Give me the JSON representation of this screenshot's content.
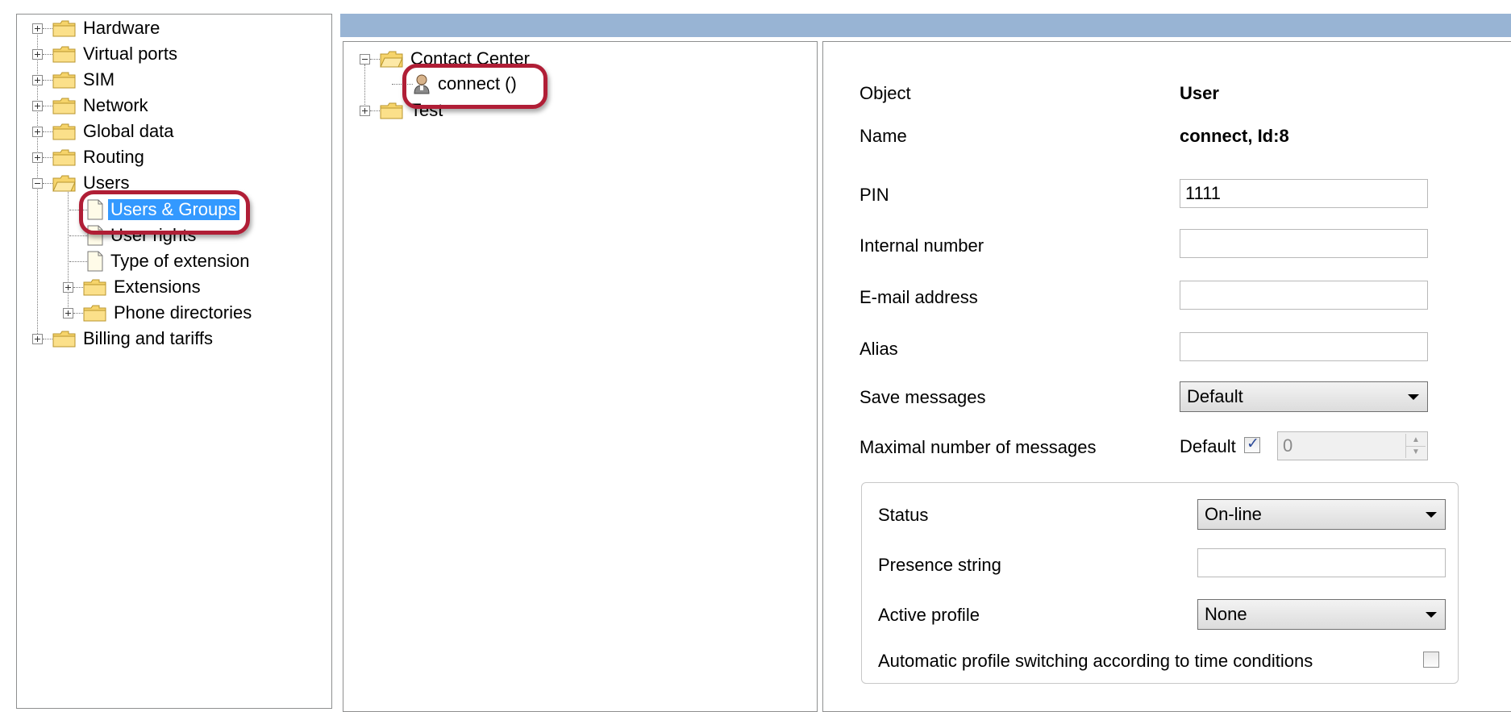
{
  "left_tree": {
    "items": [
      {
        "label": "Hardware"
      },
      {
        "label": "Virtual ports"
      },
      {
        "label": "SIM"
      },
      {
        "label": "Network"
      },
      {
        "label": "Global data"
      },
      {
        "label": "Routing"
      },
      {
        "label": "Users"
      },
      {
        "label": "Users & Groups",
        "selected": true
      },
      {
        "label": "User rights"
      },
      {
        "label": "Type of extension"
      },
      {
        "label": "Extensions"
      },
      {
        "label": "Phone directories"
      },
      {
        "label": "Billing and tariffs"
      }
    ]
  },
  "mid_tree": {
    "items": [
      {
        "label": "Contact Center"
      },
      {
        "label": "connect ()"
      },
      {
        "label": "Test"
      }
    ]
  },
  "form": {
    "object_label": "Object",
    "object_value": "User",
    "name_label": "Name",
    "name_value": "connect, Id:8",
    "pin_label": "PIN",
    "pin_value": "1111",
    "internal_number_label": "Internal number",
    "internal_number_value": "",
    "email_label": "E-mail address",
    "email_value": "",
    "alias_label": "Alias",
    "alias_value": "",
    "save_messages_label": "Save messages",
    "save_messages_value": "Default",
    "max_messages_label": "Maximal number of messages",
    "max_messages_default_label": "Default",
    "max_messages_default_checked": true,
    "max_messages_value": "0"
  },
  "presence": {
    "status_label": "Status",
    "status_value": "On-line",
    "presence_string_label": "Presence string",
    "presence_string_value": "",
    "active_profile_label": "Active profile",
    "active_profile_value": "None",
    "auto_switch_label": "Automatic profile switching according to time conditions",
    "auto_switch_checked": false
  },
  "colors": {
    "header_bar": "#98b4d4",
    "selection": "#3399ff",
    "highlight_oval": "#b01e36"
  }
}
